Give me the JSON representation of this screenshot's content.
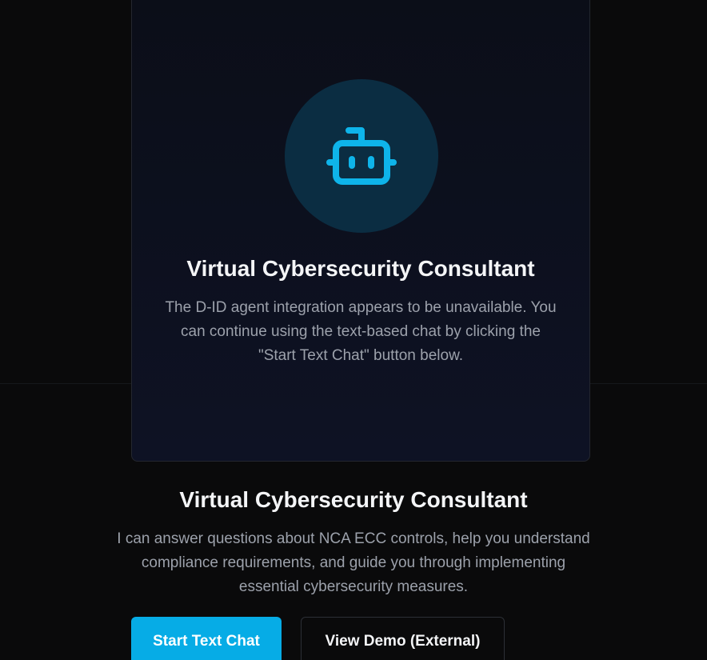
{
  "agent_card": {
    "icon": "bot-icon",
    "title": "Virtual Cybersecurity Consultant",
    "message": "The D-ID agent integration appears to be unavailable. You can continue using the text-based chat by clicking the \"Start Text Chat\" button below."
  },
  "intro": {
    "title": "Virtual Cybersecurity Consultant",
    "description": "I can answer questions about NCA ECC controls, help you understand compliance requirements, and guide you through implementing essential cybersecurity measures."
  },
  "actions": {
    "start_chat_label": "Start Text Chat",
    "view_demo_label": "View Demo (External)"
  },
  "colors": {
    "accent": "#06ace6",
    "icon_circle": "#0b2d42",
    "background": "#0a0a0b"
  }
}
